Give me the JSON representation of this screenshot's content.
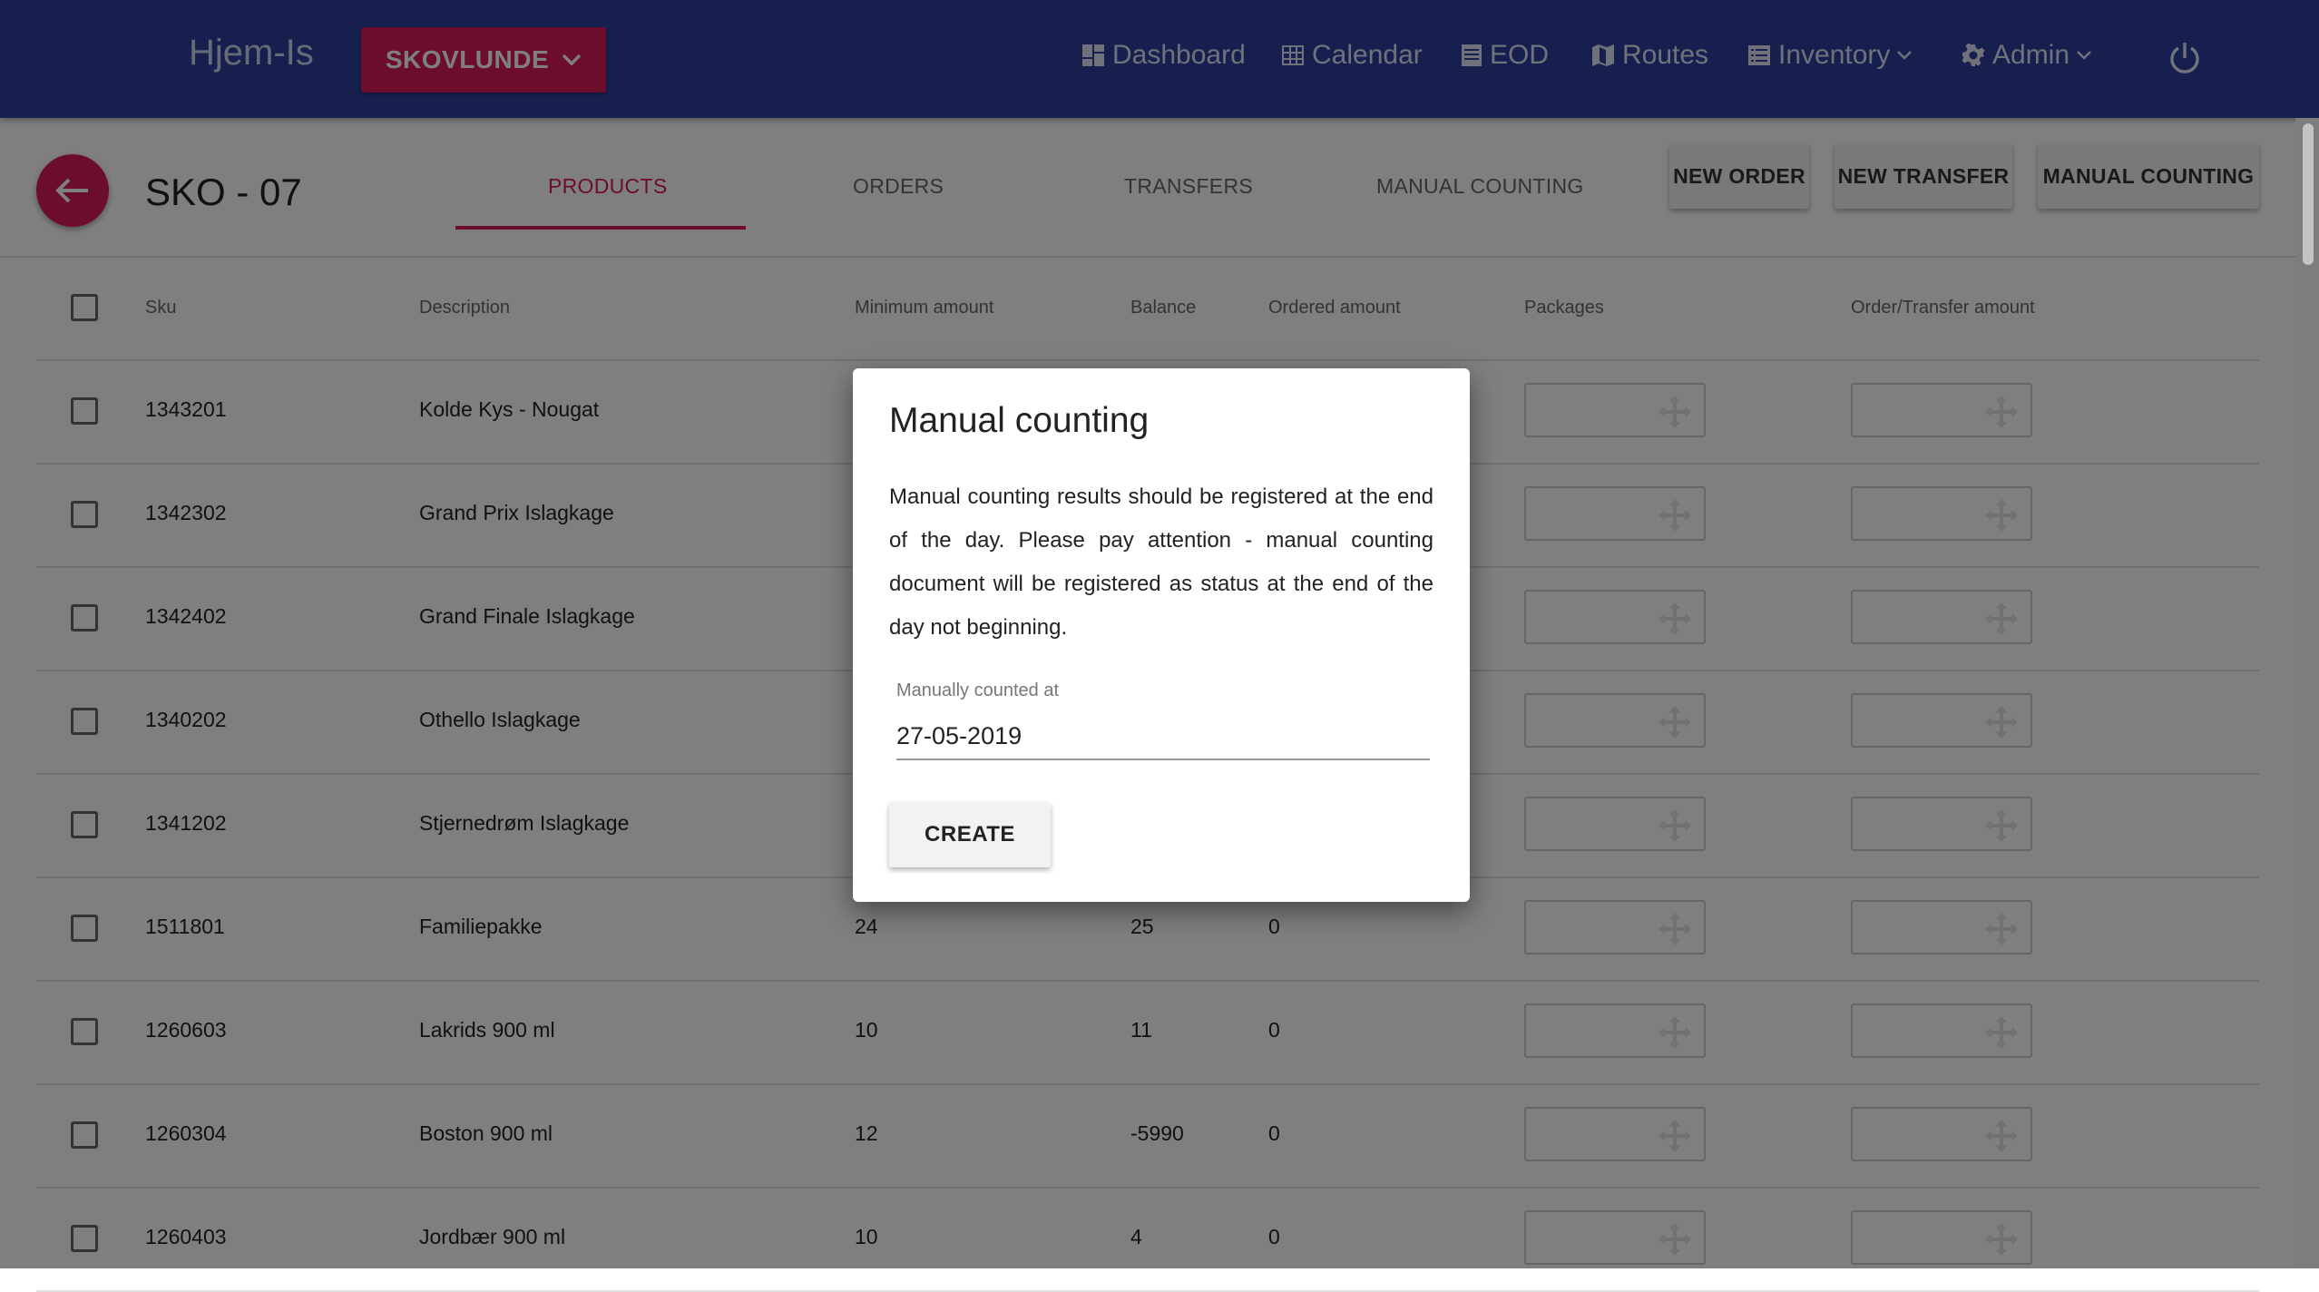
{
  "navbar": {
    "brand": "Hjem-Is",
    "store_selector": "SKOVLUNDE",
    "items": [
      {
        "label": "Dashboard",
        "icon": "dashboard-icon"
      },
      {
        "label": "Calendar",
        "icon": "calendar-icon"
      },
      {
        "label": "EOD",
        "icon": "document-icon"
      },
      {
        "label": "Routes",
        "icon": "map-icon"
      },
      {
        "label": "Inventory",
        "icon": "list-icon"
      },
      {
        "label": "Admin",
        "icon": "gear-icon"
      }
    ],
    "colors": {
      "bar": "#2f3f9e",
      "accent": "#d81b5a"
    }
  },
  "page": {
    "title": "SKO - 07",
    "tabs": [
      "PRODUCTS",
      "ORDERS",
      "TRANSFERS",
      "MANUAL COUNTING"
    ],
    "active_tab": "PRODUCTS",
    "actions": [
      "NEW ORDER",
      "NEW TRANSFER",
      "MANUAL COUNTING"
    ]
  },
  "table": {
    "headers": {
      "sku": "Sku",
      "description": "Description",
      "minimum": "Minimum amount",
      "balance": "Balance",
      "ordered": "Ordered amount",
      "packages": "Packages",
      "order_transfer": "Order/Transfer amount"
    },
    "rows": [
      {
        "sku": "1343201",
        "description": "Kolde Kys - Nougat",
        "minimum": "",
        "balance": "",
        "ordered": ""
      },
      {
        "sku": "1342302",
        "description": "Grand Prix Islagkage",
        "minimum": "",
        "balance": "",
        "ordered": ""
      },
      {
        "sku": "1342402",
        "description": "Grand Finale Islagkage",
        "minimum": "",
        "balance": "",
        "ordered": ""
      },
      {
        "sku": "1340202",
        "description": "Othello Islagkage",
        "minimum": "",
        "balance": "",
        "ordered": ""
      },
      {
        "sku": "1341202",
        "description": "Stjernedrøm Islagkage",
        "minimum": "",
        "balance": "",
        "ordered": ""
      },
      {
        "sku": "1511801",
        "description": "Familiepakke",
        "minimum": "24",
        "balance": "25",
        "ordered": "0"
      },
      {
        "sku": "1260603",
        "description": "Lakrids 900 ml",
        "minimum": "10",
        "balance": "11",
        "ordered": "0"
      },
      {
        "sku": "1260304",
        "description": "Boston 900 ml",
        "minimum": "12",
        "balance": "-5990",
        "ordered": "0"
      },
      {
        "sku": "1260403",
        "description": "Jordbær 900 ml",
        "minimum": "10",
        "balance": "4",
        "ordered": "0"
      }
    ]
  },
  "modal": {
    "title": "Manual counting",
    "body": "Manual counting results should be registered at the end of the day. Please pay attention - manual counting document will be registered as status at the end of the day not beginning.",
    "field_label": "Manually counted at",
    "field_value": "27-05-2019",
    "create_label": "CREATE"
  }
}
